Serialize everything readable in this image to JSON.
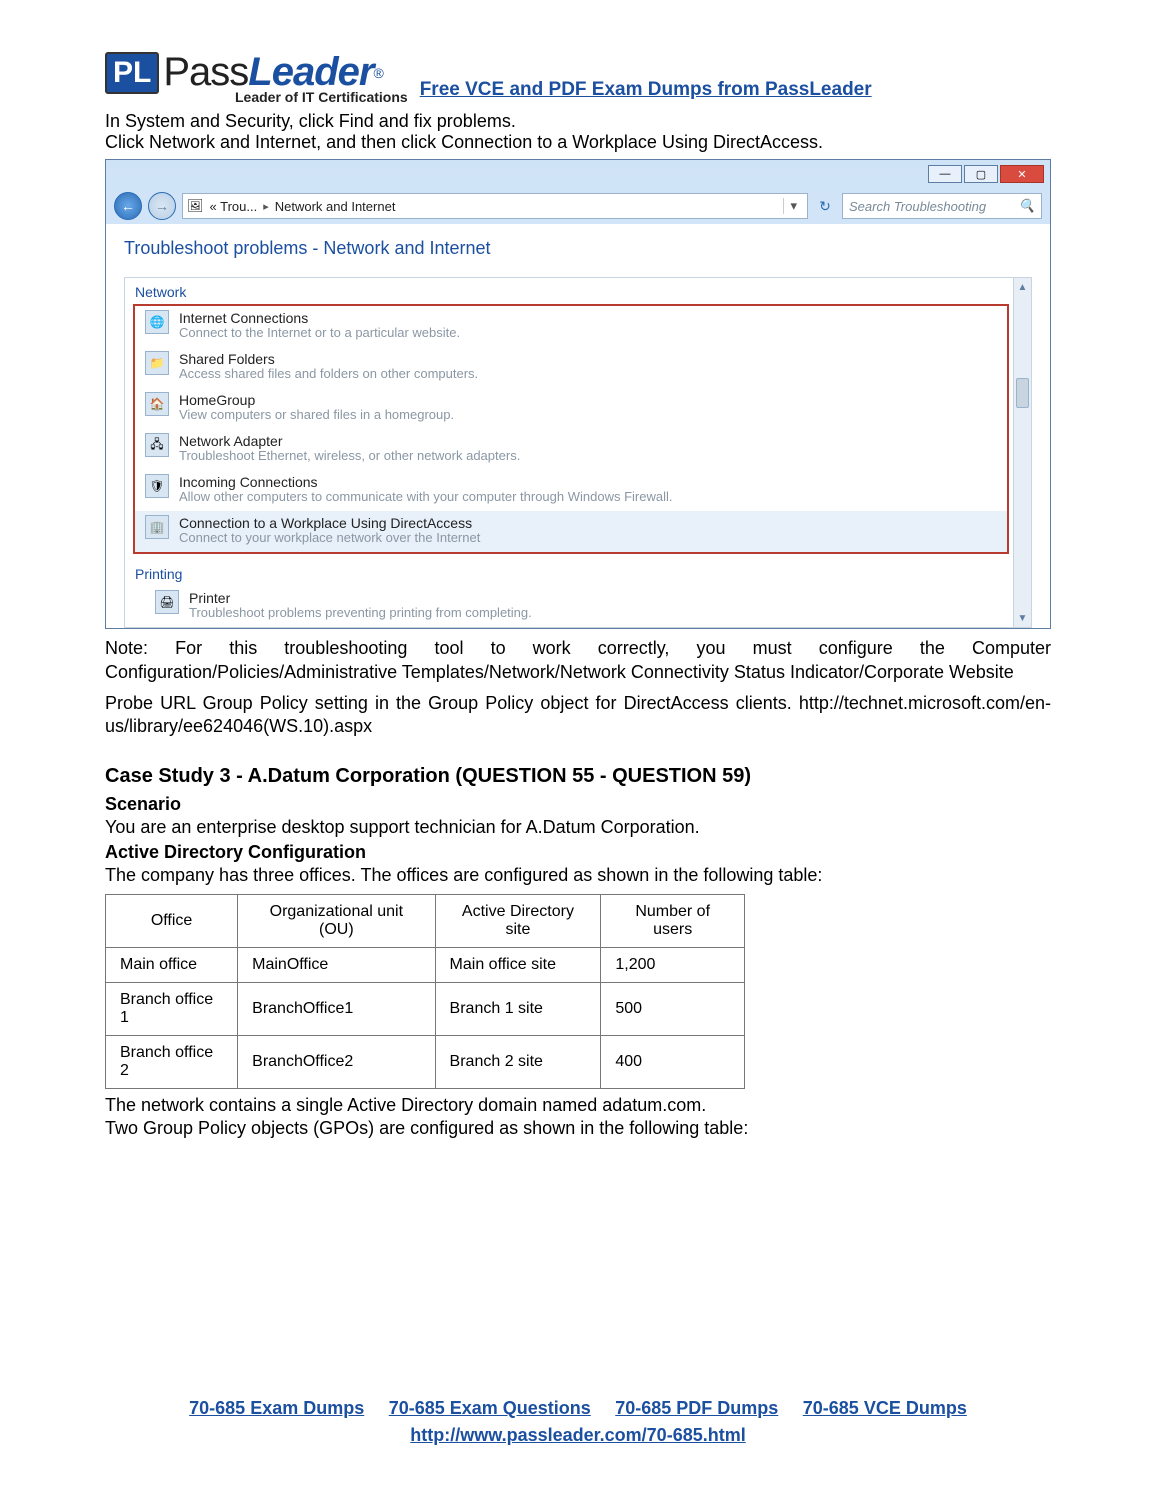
{
  "header": {
    "logo_pass": "Pass",
    "logo_leader": "Leader",
    "logo_reg": "®",
    "tagline": "Leader of IT Certifications",
    "link": "Free VCE and PDF Exam Dumps from PassLeader"
  },
  "intro": {
    "l1": "In System and Security, click Find and fix problems.",
    "l2": "Click Network and Internet, and then click Connection to a Workplace Using DirectAccess."
  },
  "win": {
    "crumb_prefix": "« Trou...",
    "crumb_sep": "▸",
    "crumb_current": "Network and Internet",
    "search_placeholder": "Search Troubleshooting",
    "heading": "Troubleshoot problems - Network and Internet",
    "group_network": "Network",
    "group_printing": "Printing",
    "items": [
      {
        "t": "Internet Connections",
        "d": "Connect to the Internet or to a particular website."
      },
      {
        "t": "Shared Folders",
        "d": "Access shared files and folders on other computers."
      },
      {
        "t": "HomeGroup",
        "d": "View computers or shared files in a homegroup."
      },
      {
        "t": "Network Adapter",
        "d": "Troubleshoot Ethernet, wireless, or other network adapters."
      },
      {
        "t": "Incoming Connections",
        "d": "Allow other computers to communicate with your computer through Windows Firewall."
      },
      {
        "t": "Connection to a Workplace Using DirectAccess",
        "d": "Connect to your workplace network over the Internet"
      }
    ],
    "printer": {
      "t": "Printer",
      "d": "Troubleshoot problems preventing printing from completing."
    }
  },
  "note": {
    "p1": "Note: For this troubleshooting tool to work correctly, you must configure the Computer Configuration/Policies/Administrative Templates/Network/Network Connectivity Status Indicator/Corporate Website",
    "p2": "Probe URL Group Policy setting in the Group Policy object for DirectAccess clients. http://technet.microsoft.com/en-us/library/ee624046(WS.10).aspx"
  },
  "case": {
    "title": "Case Study 3 - A.Datum Corporation (QUESTION 55 - QUESTION 59)",
    "scenario_h": "Scenario",
    "scenario_p": "You are an enterprise desktop support technician for A.Datum Corporation.",
    "ad_h": "Active Directory Configuration",
    "ad_p": "The company has three offices. The offices are configured as shown in the following table:",
    "after1": "The network contains a single Active Directory domain named adatum.com.",
    "after2": "Two Group Policy objects (GPOs) are configured as shown in the following table:"
  },
  "table": {
    "h": [
      "Office",
      "Organizational unit (OU)",
      "Active Directory site",
      "Number of users"
    ],
    "rows": [
      [
        "Main office",
        "MainOffice",
        "Main office site",
        "1,200"
      ],
      [
        "Branch office 1",
        "BranchOffice1",
        "Branch 1 site",
        "500"
      ],
      [
        "Branch office 2",
        "BranchOffice2",
        "Branch 2 site",
        "400"
      ]
    ]
  },
  "footer": {
    "links": [
      "70-685 Exam Dumps",
      "70-685 Exam Questions",
      "70-685 PDF Dumps",
      "70-685 VCE Dumps"
    ],
    "url": "http://www.passleader.com/70-685.html"
  }
}
